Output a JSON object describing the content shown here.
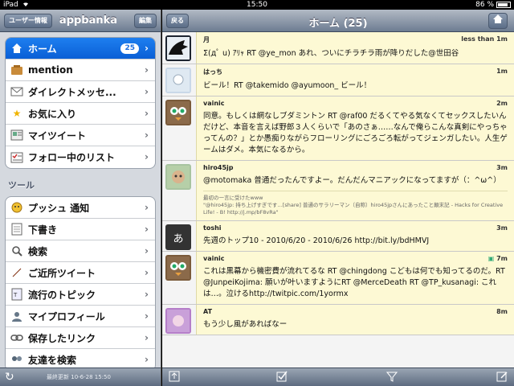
{
  "statusbar": {
    "device": "iPad",
    "wifi_icon": "wifi-icon",
    "time": "15:50",
    "battery_text": "86 %",
    "battery_level": 0.86
  },
  "left": {
    "account_button": "ユーザー情報",
    "title": "appbanka",
    "edit_button": "編集",
    "menu": [
      {
        "label": "ホーム",
        "icon": "house-icon",
        "badge": "25",
        "selected": true
      },
      {
        "label": "mention",
        "icon": "mention-icon"
      },
      {
        "label": "ダイレクトメッセ...",
        "icon": "envelope-icon"
      },
      {
        "label": "お気に入り",
        "icon": "star-icon"
      },
      {
        "label": "マイツイート",
        "icon": "speech-icon"
      },
      {
        "label": "フォロー中のリスト",
        "icon": "list-icon"
      }
    ],
    "tools_header": "ツール",
    "tools": [
      {
        "label": "プッシュ 通知",
        "icon": "push-icon"
      },
      {
        "label": "下書き",
        "icon": "draft-icon"
      },
      {
        "label": "検索",
        "icon": "magnifier-icon"
      },
      {
        "label": "ご近所ツイート",
        "icon": "compass-icon"
      },
      {
        "label": "流行のトピック",
        "icon": "trend-icon"
      },
      {
        "label": "マイプロフィール",
        "icon": "profile-icon"
      },
      {
        "label": "保存したリンク",
        "icon": "link-icon"
      },
      {
        "label": "友達を検索",
        "icon": "friends-icon"
      }
    ],
    "updated_label": "最終更新",
    "updated_value": "10-6-28 15:50"
  },
  "right": {
    "back_button": "戻る",
    "title": "ホーム (25)",
    "home_icon": "home-icon",
    "tweets": [
      {
        "user": "月",
        "time": "less than 1m",
        "text": "Σ(дﾟ u) ｱﾘｬ RT @ye_mon あれ、ついにチラチラ雨が降りだした@世田谷",
        "avatar_color": "#1d2430"
      },
      {
        "user": "はっち",
        "time": "1m",
        "text": "ビール！RT @takemido @ayumoon_ ビール！",
        "avatar_color": "#c9d8e8"
      },
      {
        "user": "vainic",
        "time": "2m",
        "text": "同意。もしくは網なしブダミントン RT @raf00 だるくてやる気なくてセックスしたいんだけど、本音を言えば野郎３人くらいで「あのさぁ……なんで俺らこんな真剣にやっちゃってんの？」とか愚痴りながらフローリングにごろごろ転がってジェンガしたい。人生ゲームはダメ。本気になるから。",
        "avatar_color": "#7a5a3a"
      },
      {
        "user": "hiro45jp",
        "time": "3m",
        "text": "@motomaka 普通だったんですよー。だんだんマニアックになってますが（：^ω^）",
        "quote": "最初の一言に受けたwww\n\"@hiro45jp: 持ち上げすぎです…[share] 普通のサラリーマン（自称）hiro45jpさんにあったこと顛末記 - Hacks for Creative Life! - B! http://j.mp/bF8vRa\"",
        "avatar_color": "#a8c4a0"
      },
      {
        "user": "toshi",
        "time": "3m",
        "text": "先週のトップ10 - 2010/6/20 - 2010/6/26 http://bit.ly/bdHMVJ",
        "avatar_color": "#333333",
        "avatar_text": "あ"
      },
      {
        "user": "vainic",
        "time": "7m",
        "text": "これは黒幕から機密費が流れてるな RT @chingdong こどもは何でも知ってるのだ。RT @JunpeiKojima: 願いが叶いますようにRT @MerceDeath RT @TP_kusanagi: これは…。泣けるhttp://twitpic.com/1yormx",
        "avatar_color": "#7a5a3a"
      },
      {
        "user": "AT",
        "time": "8m",
        "text": "もう少し風があればなー",
        "avatar_color": "#b57ec9"
      }
    ],
    "bottom_icons": [
      "upload-icon",
      "checkbox-icon",
      "filter-icon",
      "compose-icon"
    ]
  }
}
